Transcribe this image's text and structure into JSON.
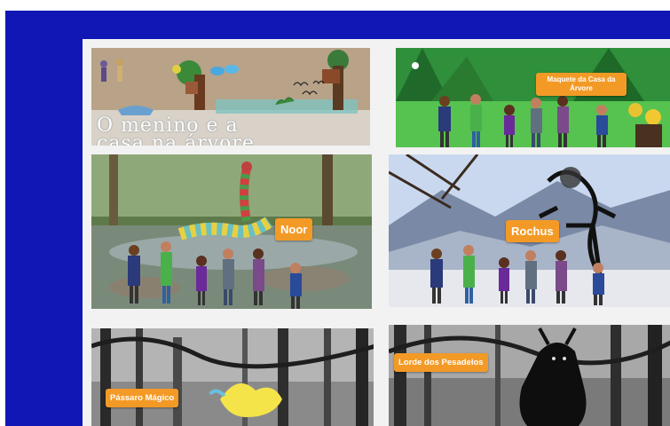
{
  "tiles": [
    {
      "title_line1": "O menino e a",
      "title_line2": "casa na árvore"
    },
    {
      "label_line1": "Maquete da Casa da",
      "label_line2": "Árvore"
    },
    {
      "label": "Noor"
    },
    {
      "label": "Rochus"
    },
    {
      "label": "Pássaro Mágico"
    },
    {
      "label": "Lorde dos Pesadelos"
    }
  ],
  "colors": {
    "frame": "#1017b4",
    "label_bg": "#f39a26",
    "label_text": "#ffffff"
  }
}
